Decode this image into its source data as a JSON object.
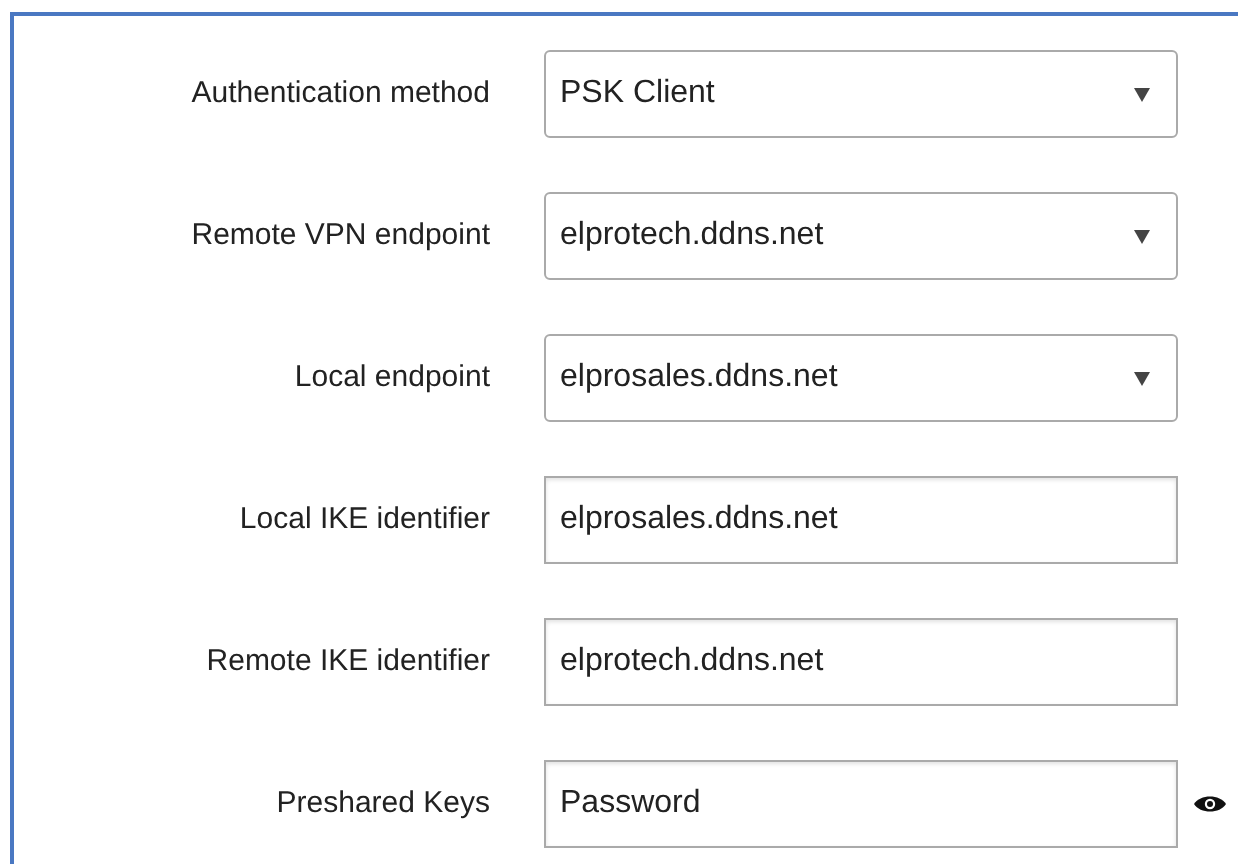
{
  "fields": [
    {
      "label": "Authentication method",
      "kind": "select",
      "value": "PSK Client"
    },
    {
      "label": "Remote VPN endpoint",
      "kind": "select",
      "value": "elprotech.ddns.net"
    },
    {
      "label": "Local endpoint",
      "kind": "select",
      "value": "elprosales.ddns.net"
    },
    {
      "label": "Local IKE identifier",
      "kind": "text",
      "value": "elprosales.ddns.net"
    },
    {
      "label": "Remote IKE identifier",
      "kind": "text",
      "value": "elprotech.ddns.net"
    },
    {
      "label": "Preshared Keys",
      "kind": "password",
      "value": "Password"
    }
  ]
}
